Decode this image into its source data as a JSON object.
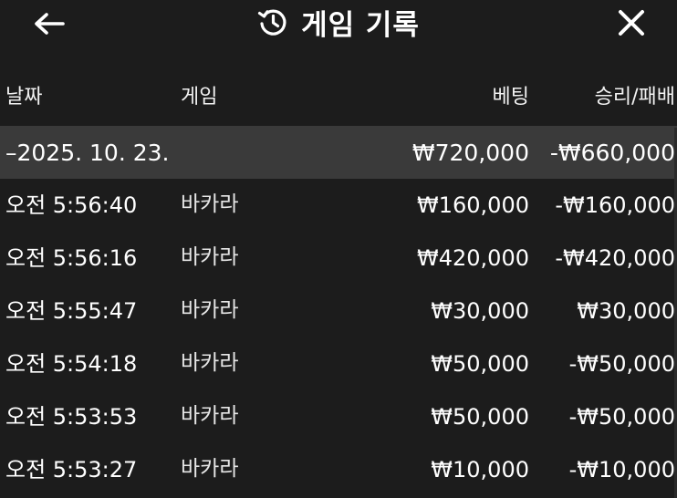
{
  "header": {
    "title": "게임 기록",
    "back_icon": "arrow-left-icon",
    "history_icon": "history-icon",
    "close_icon": "close-icon"
  },
  "columns": {
    "date": "날짜",
    "game": "게임",
    "bet": "베팅",
    "result": "승리/패배"
  },
  "group": {
    "date": "–2025. 10. 23.",
    "bet_total": "₩720,000",
    "result_total": "-₩660,000"
  },
  "rows": [
    {
      "time": "오전 5:56:40",
      "game": "바카라",
      "bet": "₩160,000",
      "result": "-₩160,000"
    },
    {
      "time": "오전 5:56:16",
      "game": "바카라",
      "bet": "₩420,000",
      "result": "-₩420,000"
    },
    {
      "time": "오전 5:55:47",
      "game": "바카라",
      "bet": "₩30,000",
      "result": "₩30,000"
    },
    {
      "time": "오전 5:54:18",
      "game": "바카라",
      "bet": "₩50,000",
      "result": "-₩50,000"
    },
    {
      "time": "오전 5:53:53",
      "game": "바카라",
      "bet": "₩50,000",
      "result": "-₩50,000"
    },
    {
      "time": "오전 5:53:27",
      "game": "바카라",
      "bet": "₩10,000",
      "result": "-₩10,000"
    }
  ],
  "colors": {
    "background": "#1c1c1c",
    "group_row": "#3a3a3a",
    "text": "#ffffff"
  }
}
